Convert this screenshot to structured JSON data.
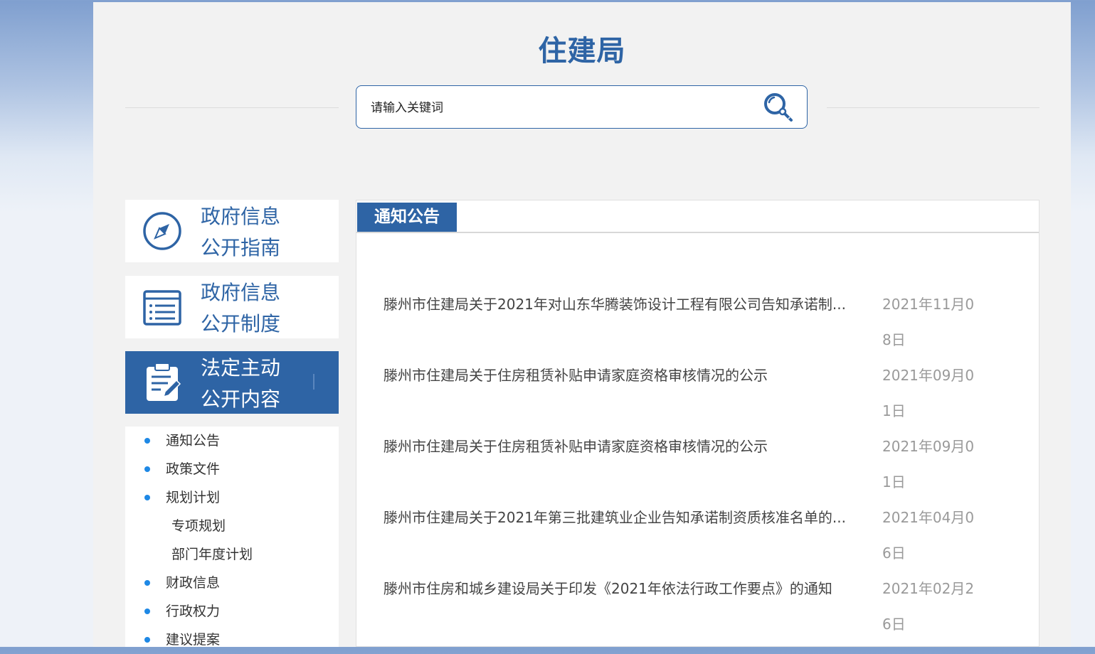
{
  "header": {
    "title": "住建局"
  },
  "search": {
    "placeholder": "请输入关键词",
    "icon": "search-key-icon"
  },
  "sidebar": {
    "cards": [
      {
        "line1": "政府信息",
        "line2": "公开指南",
        "icon": "compass-icon"
      },
      {
        "line1": "政府信息",
        "line2": "公开制度",
        "icon": "list-document-icon"
      },
      {
        "line1": "法定主动",
        "line2": "公开内容",
        "icon": "clipboard-edit-icon",
        "active": true
      }
    ],
    "items": [
      {
        "label": "通知公告",
        "level": 1
      },
      {
        "label": "政策文件",
        "level": 1
      },
      {
        "label": "规划计划",
        "level": 1
      },
      {
        "label": "专项规划",
        "level": 2
      },
      {
        "label": "部门年度计划",
        "level": 2
      },
      {
        "label": "财政信息",
        "level": 1
      },
      {
        "label": "行政权力",
        "level": 1
      },
      {
        "label": "建议提案",
        "level": 1
      }
    ]
  },
  "main": {
    "tab_label": "通知公告",
    "news": [
      {
        "title": "滕州市住建局关于2021年对山东华腾装饰设计工程有限公司告知承诺制...",
        "date": "2021年11月08日"
      },
      {
        "title": "滕州市住建局关于住房租赁补贴申请家庭资格审核情况的公示",
        "date": "2021年09月01日"
      },
      {
        "title": "滕州市住建局关于住房租赁补贴申请家庭资格审核情况的公示",
        "date": "2021年09月01日"
      },
      {
        "title": "滕州市住建局关于2021年第三批建筑业企业告知承诺制资质核准名单的...",
        "date": "2021年04月06日"
      },
      {
        "title": "滕州市住房和城乡建设局关于印发《2021年依法行政工作要点》的通知",
        "date": "2021年02月26日"
      }
    ]
  },
  "colors": {
    "brand": "#2e64a5",
    "accent_dot": "#1e88e5",
    "date": "#9a9a9a"
  }
}
